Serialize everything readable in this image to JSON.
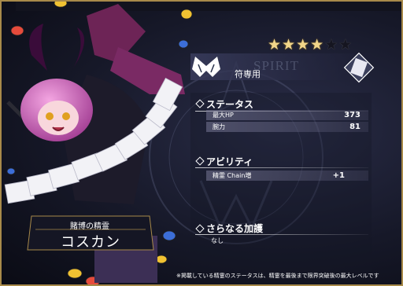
{
  "rarity": {
    "stars_total": 6,
    "stars_filled": 4
  },
  "header": {
    "watermark_text": "SPIRIT",
    "exclusive_label": "符専用"
  },
  "status": {
    "title": "ステータス",
    "stats": [
      {
        "label": "最大HP",
        "value": "373"
      },
      {
        "label": "腕力",
        "value": "81"
      }
    ]
  },
  "ability": {
    "title": "アビリティ",
    "rows": [
      {
        "label": "精霊 Chain増",
        "value": "+1"
      }
    ]
  },
  "bonus": {
    "title": "さらなる加護",
    "text": "なし"
  },
  "spirit": {
    "category": "賭博の精霊",
    "name": "コスカン"
  },
  "footnote": "※掲載している精霊のステータスは、精霊を最後まで限界突破後の最大レベルです",
  "icons": [
    "butterfly-emblem-icon",
    "spirit-card-icon",
    "diamond-bullet-icon",
    "star-icon"
  ],
  "colors": {
    "star": "#f2d68a",
    "accent_pink": "#d86ab8",
    "panel": "#1f2236"
  }
}
